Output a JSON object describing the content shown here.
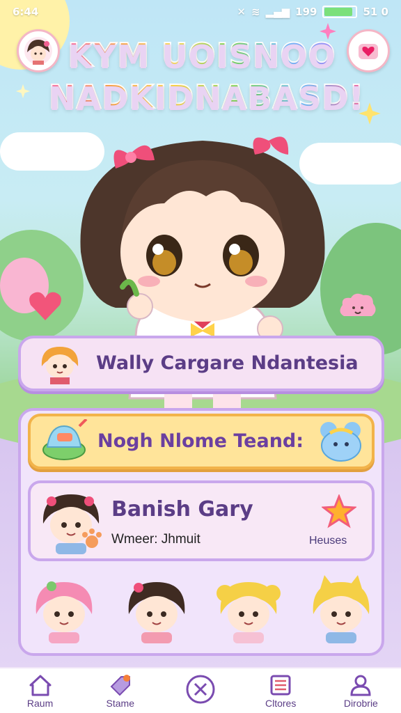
{
  "status_bar": {
    "time": "6:44",
    "right_text": "199",
    "battery_text": "51 0"
  },
  "header": {
    "title_line1": "KYM UOISNOO",
    "title_line2": "NADKIDNABASD!"
  },
  "banner": {
    "label": "Wally Cargare Ndantesia"
  },
  "panel": {
    "feature_label": "Nogh Nlome Teand:",
    "profile": {
      "name": "Banish Gary",
      "subtitle": "Wmeer: Jhmuit",
      "badge_label": "Heuses"
    },
    "characters": [
      "char-pink",
      "char-brunette",
      "char-blonde",
      "char-cat-blonde"
    ]
  },
  "tabs": [
    {
      "label": "Raum",
      "icon": "home-icon"
    },
    {
      "label": "Stame",
      "icon": "tag-icon"
    },
    {
      "label": "",
      "icon": "close-icon"
    },
    {
      "label": "Cltores",
      "icon": "list-icon"
    },
    {
      "label": "Dirobrie",
      "icon": "profile-icon"
    }
  ],
  "colors": {
    "accent_purple": "#5b3d86",
    "banner_bg": "#f7e3f6",
    "feature_bg": "#ffe49a",
    "panel_bg": "#f1e4fb"
  }
}
